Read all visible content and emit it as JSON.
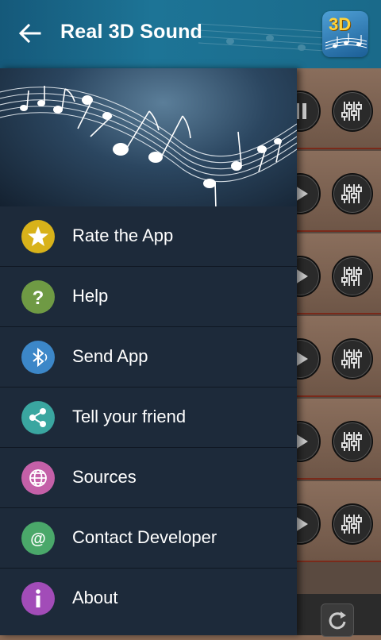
{
  "appbar": {
    "title": "Real 3D Sound",
    "app_icon_text": "3D"
  },
  "menu": [
    {
      "label": "Rate the App",
      "icon": "star-icon",
      "color": "#d8b21a"
    },
    {
      "label": "Help",
      "icon": "question-icon",
      "color": "#6f9a44"
    },
    {
      "label": "Send App",
      "icon": "bluetooth-icon",
      "color": "#3c87c8"
    },
    {
      "label": "Tell your friend",
      "icon": "share-icon",
      "color": "#3aa6a0"
    },
    {
      "label": "Sources",
      "icon": "globe-icon",
      "color": "#c460a8"
    },
    {
      "label": "Contact Developer",
      "icon": "at-icon",
      "color": "#4aa86a"
    },
    {
      "label": "About",
      "icon": "info-icon",
      "color": "#a24cb8"
    }
  ],
  "colors": {
    "appbar": "#1d7496",
    "drawer": "#1d2a3a"
  }
}
